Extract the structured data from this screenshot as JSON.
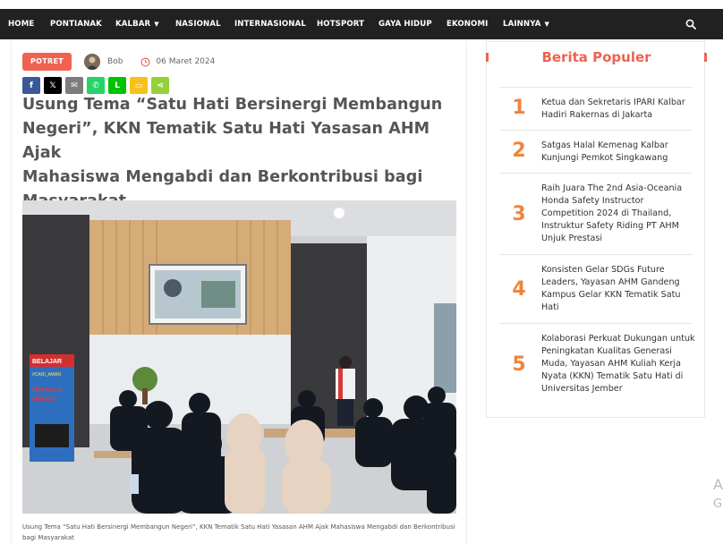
{
  "nav": {
    "items": [
      {
        "label": "HOME",
        "dropdown": false
      },
      {
        "label": "PONTIANAK",
        "dropdown": false
      },
      {
        "label": "KALBAR",
        "dropdown": true
      },
      {
        "label": "NASIONAL",
        "dropdown": false
      },
      {
        "label": "INTERNASIONAL",
        "dropdown": false
      },
      {
        "label": "HOTSPORT",
        "dropdown": false
      },
      {
        "label": "GAYA HIDUP",
        "dropdown": false
      },
      {
        "label": "EKONOMI",
        "dropdown": false
      },
      {
        "label": "LAINNYA",
        "dropdown": true
      }
    ],
    "search_icon": "search-icon",
    "background": "#212121"
  },
  "article": {
    "category": "POTRET",
    "author": "Bob",
    "date": "06 Maret 2024",
    "share": [
      {
        "name": "facebook",
        "glyph": "f",
        "color": "#3b5998"
      },
      {
        "name": "x",
        "glyph": "𝕏",
        "color": "#000000"
      },
      {
        "name": "email",
        "glyph": "✉",
        "color": "#7d7d7d"
      },
      {
        "name": "whatsapp",
        "glyph": "✆",
        "color": "#25d366"
      },
      {
        "name": "line",
        "glyph": "L",
        "color": "#00c300"
      },
      {
        "name": "sms",
        "glyph": "▭",
        "color": "#f6c21a"
      },
      {
        "name": "sharethis",
        "glyph": "⋖",
        "color": "#95d03a"
      }
    ],
    "headline_lines": [
      "Usung Tema “Satu Hati Bersinergi Membangun",
      "Negeri”, KKN Tematik Satu Hati Yasasan AHM Ajak",
      "Mahasiswa Mengabdi dan Berkontribusi bagi",
      "Masyarakat"
    ],
    "photo_banner": {
      "line1": "BELAJAR",
      "line2": "#CARI_AMAN",
      "line3": "Bersama",
      "line4": "Honda"
    },
    "caption": "Usung Tema “Satu Hati Bersinergi Membangun Negeri”, KKN Tematik Satu Hati Yasasan AHM Ajak Mahasiswa Mengabdi dan Berkontribusi bagi Masyarakat",
    "accent": "#f0624f"
  },
  "sidebar": {
    "title": "Berita Populer",
    "items": [
      {
        "num": "1",
        "title": "Ketua dan Sekretaris IPARI Kalbar Hadiri Rakernas di Jakarta"
      },
      {
        "num": "2",
        "title": "Satgas Halal Kemenag Kalbar Kunjungi Pemkot Singkawang"
      },
      {
        "num": "3",
        "title": "Raih Juara The 2nd Asia-Oceania Honda Safety Instructor Competition 2024 di Thailand, Instruktur Safety Riding PT AHM Unjuk Prestasi"
      },
      {
        "num": "4",
        "title": "Konsisten Gelar SDGs Future Leaders, Yayasan AHM Gandeng Kampus Gelar KKN Tematik Satu Hati"
      },
      {
        "num": "5",
        "title": "Kolaborasi Perkuat Dukungan untuk Peningkatan Kualitas Generasi Muda, Yayasan AHM Kuliah Kerja Nyata (KKN) Tematik Satu Hati di Universitas Jember"
      }
    ],
    "number_color": "#f0843c"
  },
  "edge_fragment": {
    "line1": "A",
    "line2": "G"
  }
}
